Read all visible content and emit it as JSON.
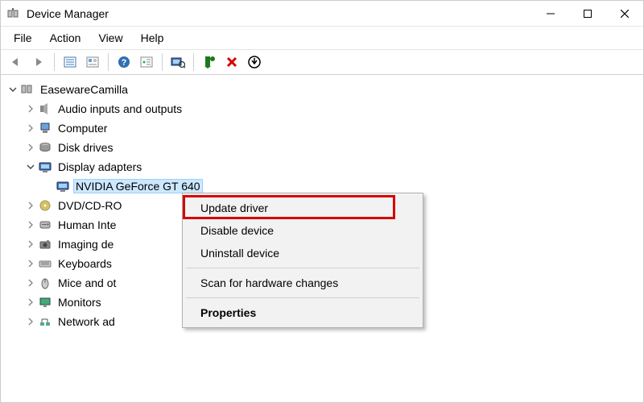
{
  "window": {
    "title": "Device Manager"
  },
  "menubar": [
    "File",
    "Action",
    "View",
    "Help"
  ],
  "toolbar_icons": [
    "back",
    "forward",
    "sep",
    "props-list",
    "props-card",
    "sep",
    "help",
    "show-hidden",
    "sep",
    "scan",
    "sep",
    "enable",
    "disable",
    "uninstall"
  ],
  "tree": {
    "root": {
      "label": "EasewareCamilla",
      "icon": "computer"
    },
    "items": [
      {
        "label": "Audio inputs and outputs",
        "icon": "audio",
        "expanded": false
      },
      {
        "label": "Computer",
        "icon": "pc",
        "expanded": false
      },
      {
        "label": "Disk drives",
        "icon": "disk",
        "expanded": false
      },
      {
        "label": "Display adapters",
        "icon": "display",
        "expanded": true,
        "children": [
          {
            "label": "NVIDIA GeForce GT 640",
            "icon": "display",
            "selected": true
          }
        ]
      },
      {
        "label": "DVD/CD-RO",
        "icon": "dvd",
        "truncated": true,
        "expanded": false
      },
      {
        "label": "Human Inte",
        "icon": "hid",
        "truncated": true,
        "expanded": false
      },
      {
        "label": "Imaging de",
        "icon": "imaging",
        "truncated": true,
        "expanded": false
      },
      {
        "label": "Keyboards",
        "icon": "keyboard",
        "expanded": false
      },
      {
        "label": "Mice and ot",
        "icon": "mouse",
        "truncated": true,
        "expanded": false
      },
      {
        "label": "Monitors",
        "icon": "monitor",
        "expanded": false
      },
      {
        "label": "Network ad",
        "icon": "network",
        "truncated": true,
        "expanded": false
      }
    ]
  },
  "context_menu": {
    "items": [
      {
        "label": "Update driver",
        "highlight": true
      },
      {
        "label": "Disable device"
      },
      {
        "label": "Uninstall device"
      },
      {
        "sep": true
      },
      {
        "label": "Scan for hardware changes"
      },
      {
        "sep": true
      },
      {
        "label": "Properties",
        "bold": true
      }
    ]
  }
}
